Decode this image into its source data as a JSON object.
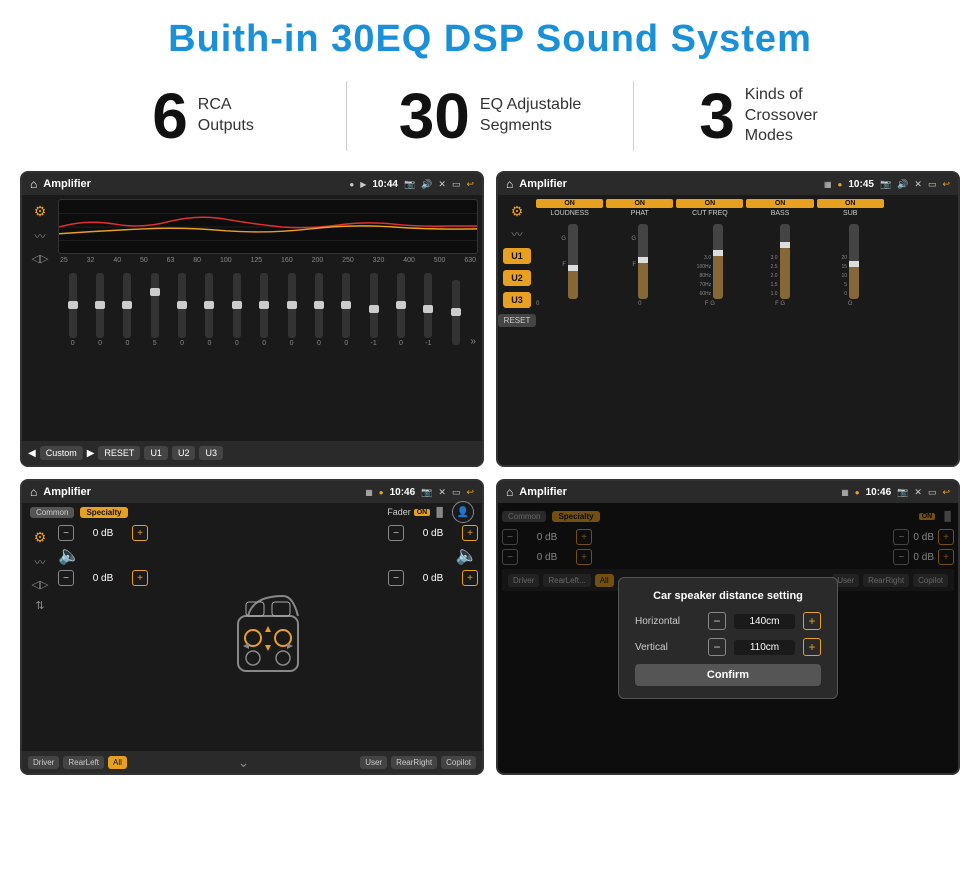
{
  "page": {
    "title": "Buith-in 30EQ DSP Sound System"
  },
  "stats": [
    {
      "number": "6",
      "text": "RCA\nOutputs"
    },
    {
      "number": "30",
      "text": "EQ Adjustable\nSegments"
    },
    {
      "number": "3",
      "text": "Kinds of\nCrossover Modes"
    }
  ],
  "screens": [
    {
      "id": "screen1",
      "title": "Amplifier",
      "time": "10:44",
      "description": "EQ Equalizer screen"
    },
    {
      "id": "screen2",
      "title": "Amplifier",
      "time": "10:45",
      "description": "Channel amplifier screen"
    },
    {
      "id": "screen3",
      "title": "Amplifier",
      "time": "10:46",
      "description": "Fader speaker layout screen"
    },
    {
      "id": "screen4",
      "title": "Amplifier",
      "time": "10:46",
      "description": "Car speaker distance dialog"
    }
  ],
  "eq": {
    "frequencies": [
      "25",
      "32",
      "40",
      "50",
      "63",
      "80",
      "100",
      "125",
      "160",
      "200",
      "250",
      "320",
      "400",
      "500",
      "630"
    ],
    "values": [
      "0",
      "0",
      "0",
      "5",
      "0",
      "0",
      "0",
      "0",
      "0",
      "0",
      "0",
      "-1",
      "0",
      "-1",
      ""
    ],
    "presets": [
      "Custom",
      "RESET",
      "U1",
      "U2",
      "U3"
    ]
  },
  "amp": {
    "channels": [
      "LOUDNESS",
      "PHAT",
      "CUT FREQ",
      "BASS",
      "SUB"
    ],
    "presets": [
      "U1",
      "U2",
      "U3"
    ],
    "resetBtn": "RESET"
  },
  "fader": {
    "tabs": [
      "Common",
      "Specialty"
    ],
    "label": "Fader",
    "onBadge": "ON",
    "dbValues": [
      "0 dB",
      "0 dB",
      "0 dB",
      "0 dB"
    ],
    "bottomBtns": [
      "Driver",
      "RearLeft",
      "All",
      "User",
      "RearRight",
      "Copilot"
    ]
  },
  "dialog": {
    "title": "Car speaker distance setting",
    "horizontal": {
      "label": "Horizontal",
      "value": "140cm"
    },
    "vertical": {
      "label": "Vertical",
      "value": "110cm"
    },
    "confirmBtn": "Confirm"
  }
}
